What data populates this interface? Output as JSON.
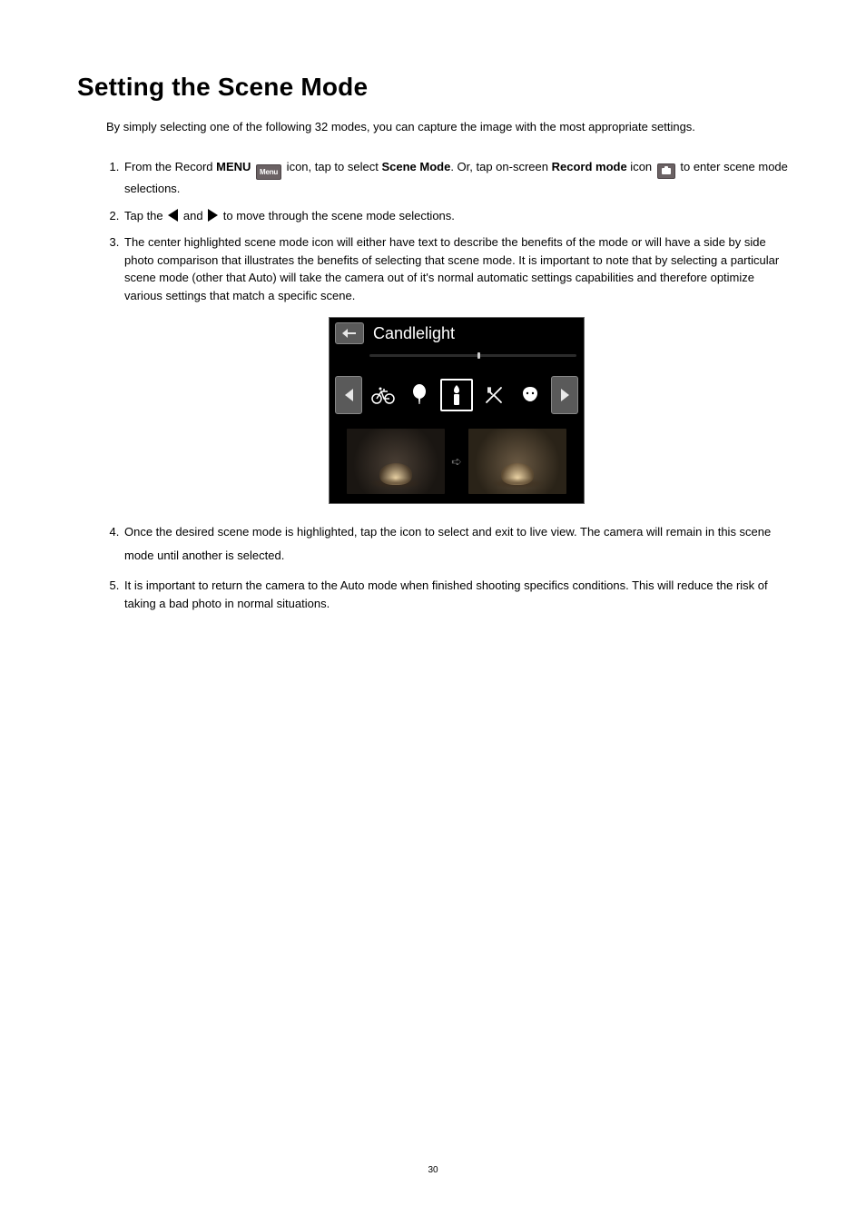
{
  "title": "Setting the Scene Mode",
  "intro": "By simply selecting one of the following 32 modes, you can capture the image with the most appropriate settings.",
  "steps": [
    {
      "pre": "From the Record ",
      "bold1": "MENU",
      "icon1": "menu",
      "icon1_label": "Menu",
      "mid1": " icon, tap to select ",
      "bold2": "Scene Mode",
      "mid2": ". Or, tap on-screen ",
      "bold3": "Record mode",
      "mid3": " icon ",
      "icon2": "record-mode",
      "post": " to enter scene mode selections."
    },
    {
      "pre": "Tap the ",
      "mid": " and ",
      "post": " to move through the scene mode selections."
    },
    {
      "text": "The center highlighted scene mode icon will either have text to describe the benefits of the mode or will have a side by side photo comparison that illustrates the benefits of selecting that scene mode.  It is important to note that by selecting a particular scene mode (other that Auto) will take the camera out of it's normal automatic settings capabilities and therefore optimize various settings that match a specific scene."
    },
    {
      "text": "Once the desired scene mode is highlighted, tap the icon to select and exit to live view.  The camera will remain in this scene mode until another is selected."
    },
    {
      "text": "It is important to return the camera to the Auto mode when finished shooting specifics conditions. This will reduce the risk of taking a bad photo in normal situations."
    }
  ],
  "screenshot": {
    "title": "Candlelight",
    "compare_arrow": "➪"
  },
  "page_number": "30"
}
